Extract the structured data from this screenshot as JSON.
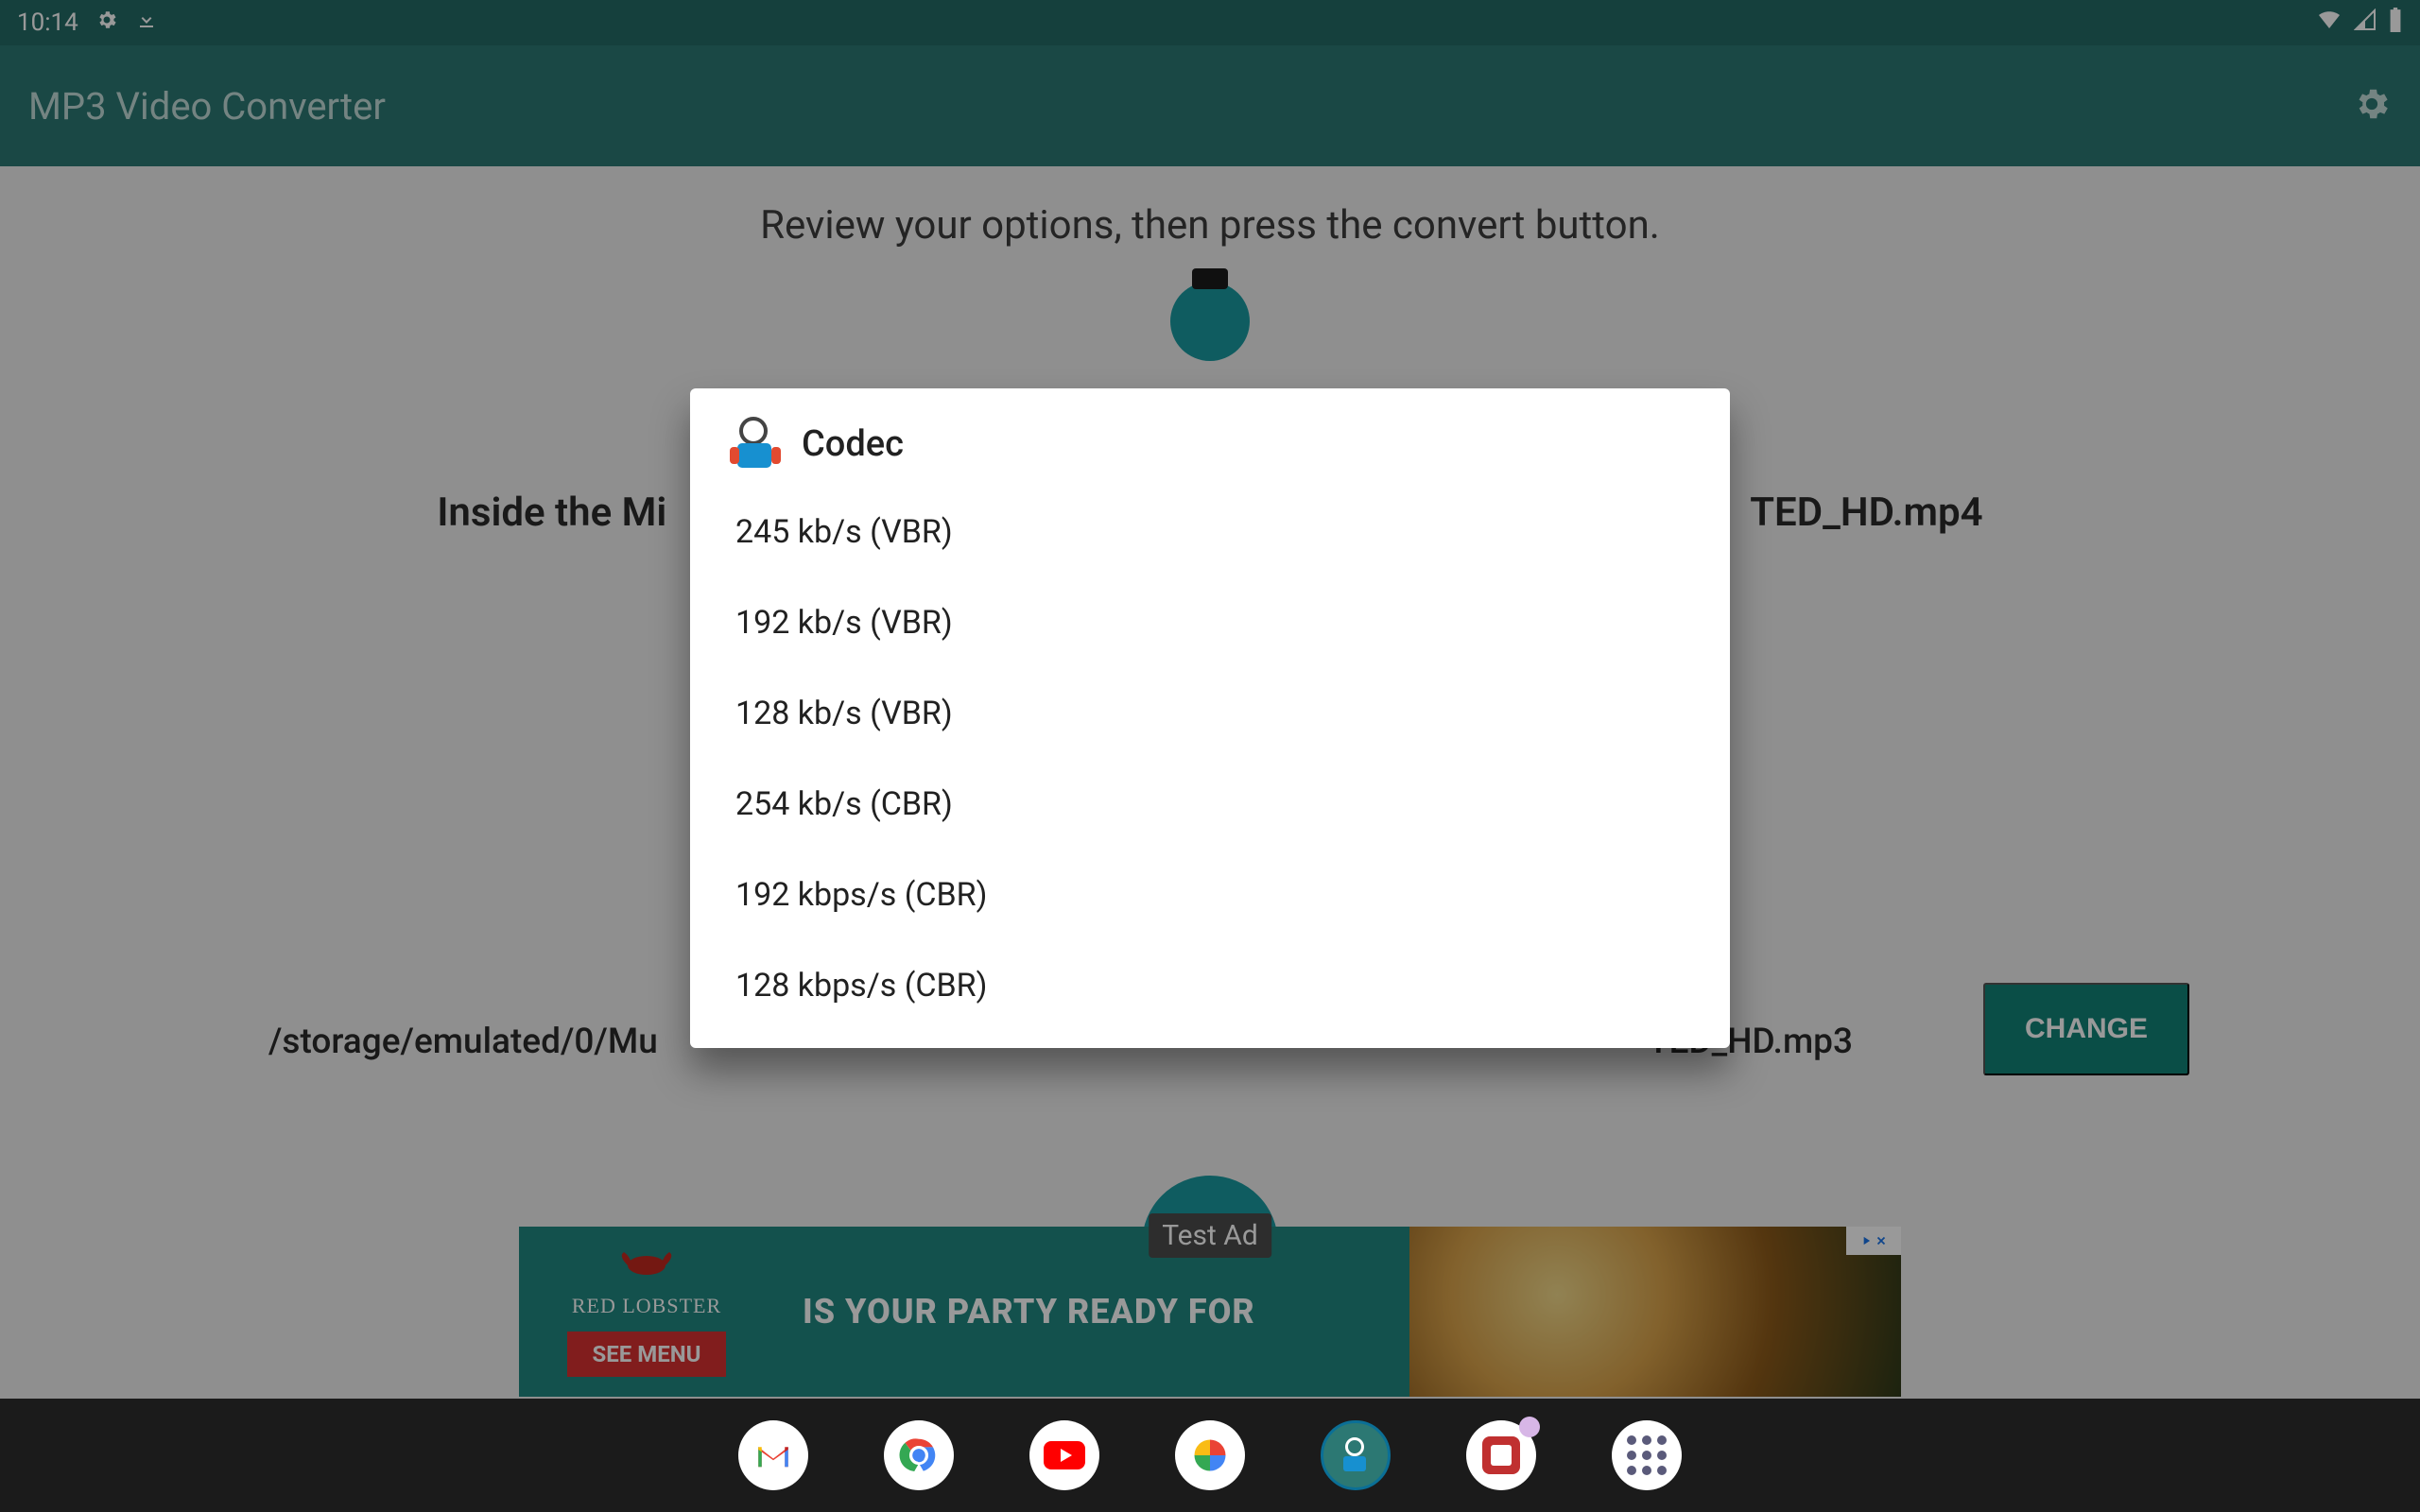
{
  "statusbar": {
    "time": "10:14"
  },
  "appbar": {
    "title": "MP3 Video Converter"
  },
  "content": {
    "instruction": "Review your options, then press the convert button.",
    "filename_left": "Inside the Mi",
    "filename_right": "TED_HD.mp4",
    "outpath_left": "/storage/emulated/0/Mu",
    "outpath_right": "TED_HD.mp3",
    "change_label": "CHANGE"
  },
  "dialog": {
    "title": "Codec",
    "items": [
      "245 kb/s (VBR)",
      "192  kb/s (VBR)",
      "128  kb/s (VBR)",
      "254 kb/s (CBR)",
      "192 kbps/s (CBR)",
      "128 kbps/s (CBR)"
    ]
  },
  "ad": {
    "tag": "Test Ad",
    "brand": "RED LOBSTER",
    "headline": "IS YOUR PARTY READY FOR",
    "cta": "SEE MENU",
    "adchoices": "▷✕"
  }
}
